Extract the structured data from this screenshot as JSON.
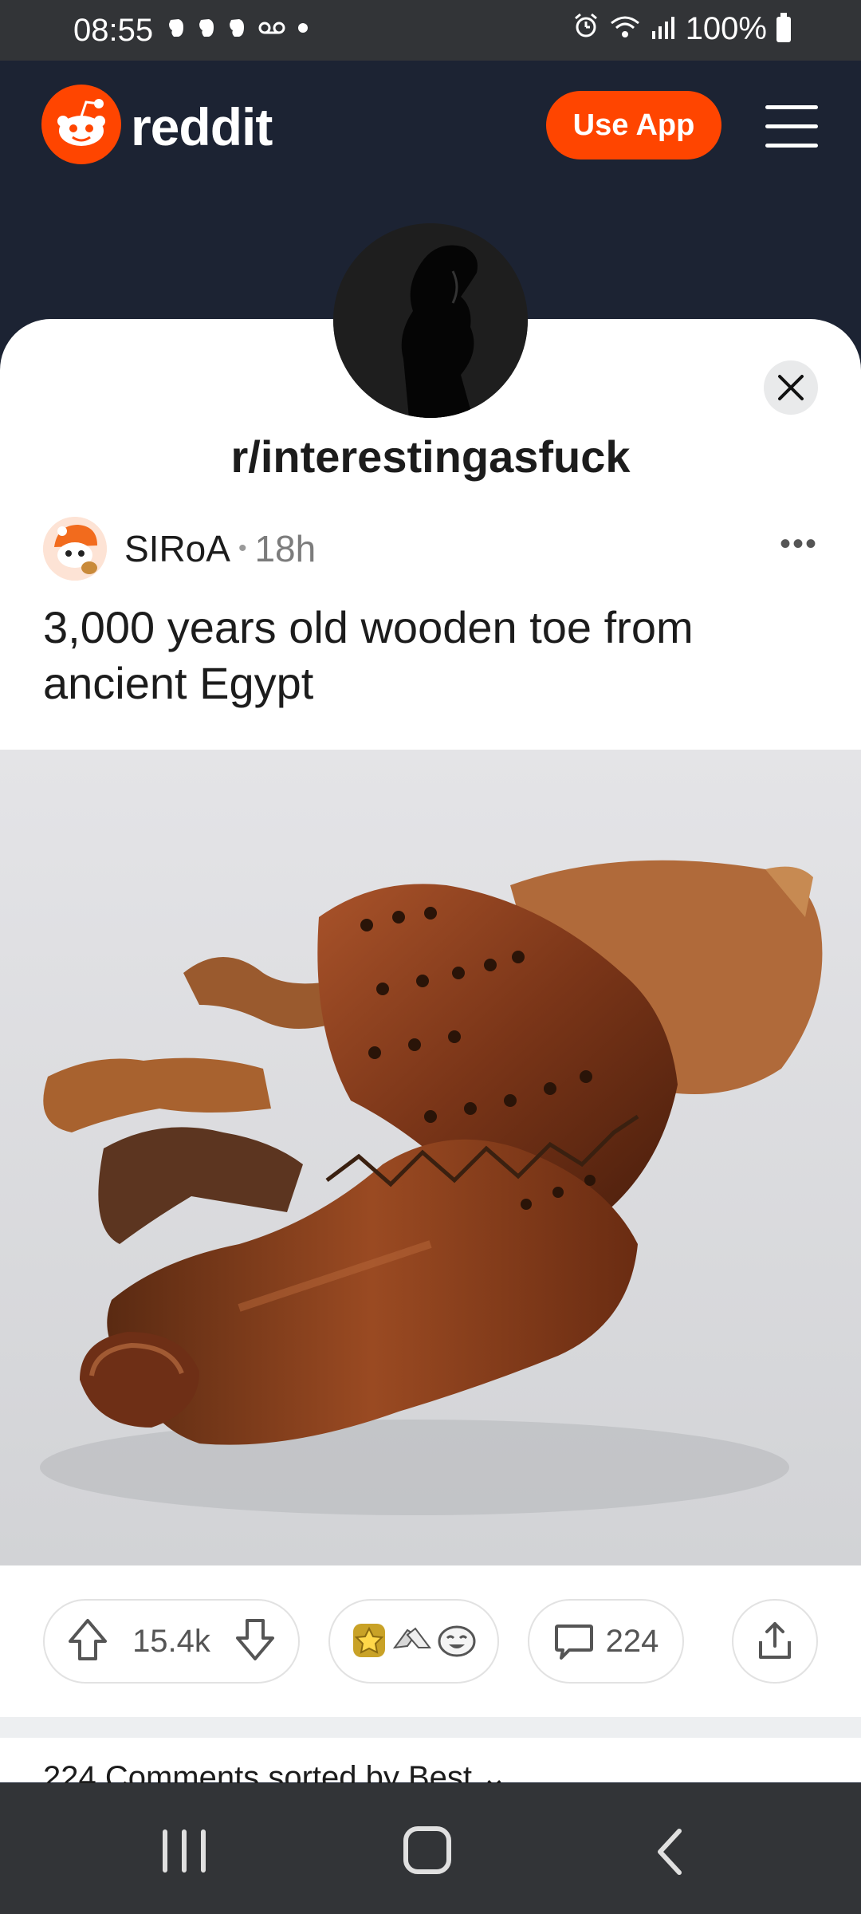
{
  "status_bar": {
    "time": "08:55",
    "battery": "100%",
    "notification_icons": [
      "evernote-icon",
      "evernote-icon",
      "evernote-icon",
      "voicemail-icon",
      "dot-icon"
    ],
    "system_icons": [
      "alarm-icon",
      "wifi-icon",
      "signal-icon",
      "battery-icon"
    ]
  },
  "header": {
    "logo_text": "reddit",
    "use_app_label": "Use App",
    "menu_icon": "hamburger-icon",
    "background": "#1c2333",
    "accent": "#ff4500"
  },
  "sheet": {
    "subreddit": "r/interestingasfuck",
    "close_icon": "close-icon"
  },
  "post": {
    "author": "SIRoA",
    "separator": "•",
    "age": "18h",
    "title": "3,000 years old wooden toe from ancient Egypt",
    "more_label": "•••",
    "upvotes": "15.4k",
    "comment_count": "224"
  },
  "comments_header": "224 Comments sorted by Best ⌄",
  "navbar": {
    "recent_icon": "recent-apps-icon",
    "home_icon": "home-icon",
    "back_icon": "back-icon"
  }
}
